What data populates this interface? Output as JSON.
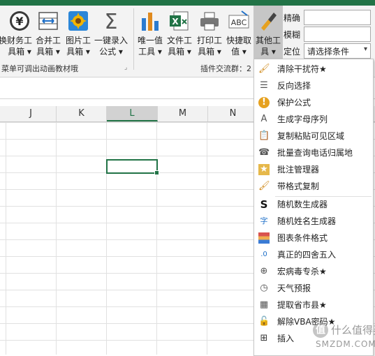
{
  "ribbon": {
    "buttons": [
      {
        "label": "换",
        "icon": "arrow-icon"
      },
      {
        "label": "财务工\n具箱 ▾",
        "icon": "yen-icon"
      },
      {
        "label": "合并工\n具箱 ▾",
        "icon": "merge-cells-icon"
      },
      {
        "label": "图片工\n具箱 ▾",
        "icon": "picture-icon"
      },
      {
        "label": "一键录入\n公式 ▾",
        "icon": "sigma-icon"
      },
      {
        "label": "唯一值\n工具 ▾",
        "icon": "bar-chart-icon"
      },
      {
        "label": "文件工\n具箱 ▾",
        "icon": "excel-file-icon"
      },
      {
        "label": "打印工\n具箱 ▾",
        "icon": "printer-icon"
      },
      {
        "label": "快捷取\n值 ▾",
        "icon": "abc-icon"
      },
      {
        "label": "其他工\n具 ▾",
        "icon": "brush-icon"
      }
    ],
    "group1_label": "菜单可调出动画教材哦",
    "group2_label": "插件交流群：2",
    "right_fields": {
      "label_precise": "精确",
      "label_fuzzy": "模糊",
      "label_locate": "定位",
      "select_value": "请选择条件"
    }
  },
  "columns": [
    "J",
    "K",
    "L",
    "M",
    "N"
  ],
  "selected_column": "L",
  "menu": {
    "items": [
      {
        "label": "清除干扰符★",
        "icon": "eraser-brush-icon",
        "glyph": "🖌"
      },
      {
        "label": "反向选择",
        "icon": "checklist-icon",
        "glyph": "☰"
      },
      {
        "label": "保护公式",
        "icon": "warning-icon",
        "glyph": "!"
      },
      {
        "label": "生成字母序列",
        "icon": "letter-a-icon",
        "glyph": "A"
      },
      {
        "label": "复制粘贴可见区域",
        "icon": "clipboard-icon",
        "glyph": "📋"
      },
      {
        "label": "批量查询电话归属地",
        "icon": "phone-icon",
        "glyph": "☎"
      },
      {
        "label": "批注管理器",
        "icon": "comment-star-icon",
        "glyph": "★"
      },
      {
        "label": "带格式复制",
        "icon": "format-painter-icon",
        "glyph": "🖌"
      },
      {
        "label": "随机数生成器",
        "icon": "dollar-s-icon",
        "glyph": "S"
      },
      {
        "label": "随机姓名生成器",
        "icon": "name-check-icon",
        "glyph": "字"
      },
      {
        "label": "图表条件格式",
        "icon": "color-bars-icon",
        "glyph": "▤"
      },
      {
        "label": "真正的四舍五入",
        "icon": "rounding-icon",
        "glyph": ".0"
      },
      {
        "label": "宏病毒专杀★",
        "icon": "globe-shield-icon",
        "glyph": "⊕"
      },
      {
        "label": "天气预报",
        "icon": "weather-clock-icon",
        "glyph": "◷"
      },
      {
        "label": "提取省市县★",
        "icon": "building-icon",
        "glyph": "▦"
      },
      {
        "label": "解除VBA密码★",
        "icon": "lock-icon",
        "glyph": "🔓"
      },
      {
        "label": "插入",
        "icon": "insert-icon",
        "glyph": "⊞"
      }
    ]
  },
  "watermark": {
    "text1": "什么值得买",
    "text2": "SMZDM.COM"
  }
}
